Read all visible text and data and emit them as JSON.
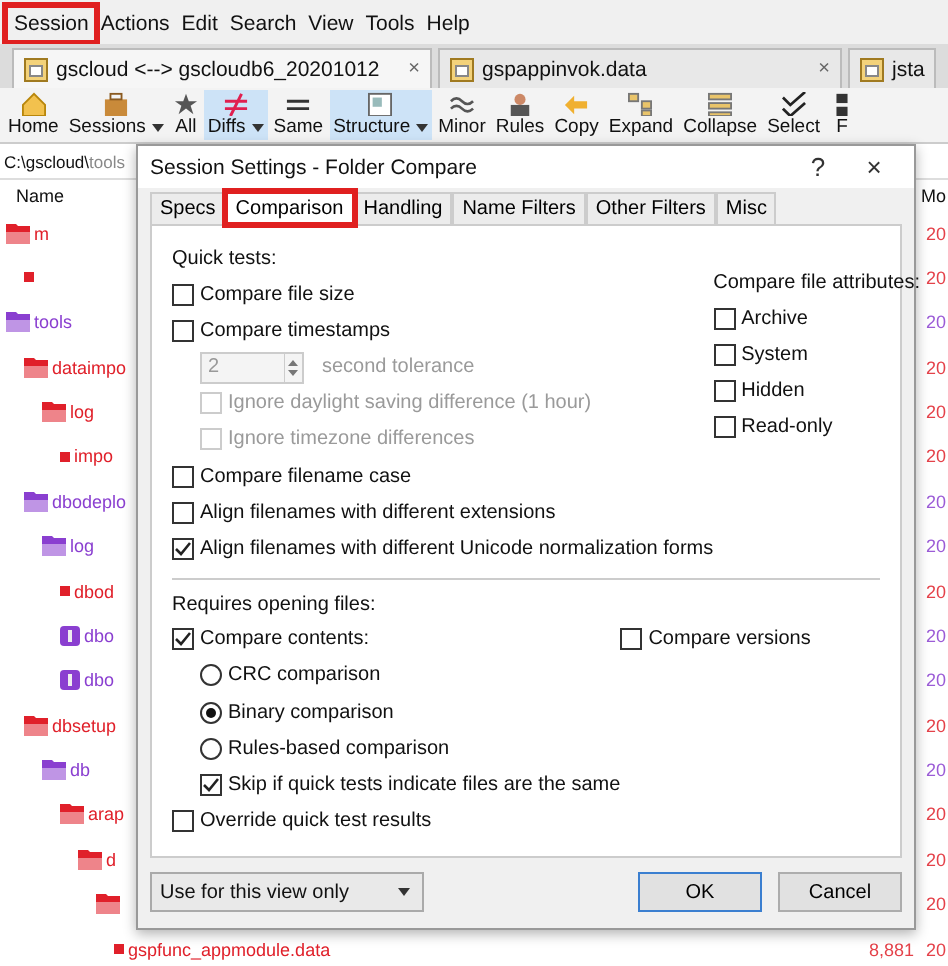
{
  "menu": [
    {
      "label": "Session",
      "highlighted": true
    },
    {
      "label": "Actions",
      "highlighted": false
    },
    {
      "label": "Edit",
      "highlighted": false
    },
    {
      "label": "Search",
      "highlighted": false
    },
    {
      "label": "View",
      "highlighted": false
    },
    {
      "label": "Tools",
      "highlighted": false
    },
    {
      "label": "Help",
      "highlighted": false
    }
  ],
  "doc_tabs": [
    {
      "label": "gscloud <--> gscloudb6_20201012",
      "selected": true,
      "close": "×"
    },
    {
      "label": "gspappinvok.data",
      "selected": false,
      "close": "×"
    },
    {
      "label": "jsta",
      "selected": false
    }
  ],
  "toolbar": [
    {
      "label": "Home",
      "selected": false,
      "dropdown": false
    },
    {
      "label": "Sessions",
      "selected": false,
      "dropdown": true
    },
    {
      "label": "All",
      "selected": false,
      "dropdown": false
    },
    {
      "label": "Diffs",
      "selected": true,
      "dropdown": true
    },
    {
      "label": "Same",
      "selected": false,
      "dropdown": false
    },
    {
      "label": "Structure",
      "selected": true,
      "dropdown": true
    },
    {
      "label": "Minor",
      "selected": false,
      "dropdown": false
    },
    {
      "label": "Rules",
      "selected": false,
      "dropdown": false
    },
    {
      "label": "Copy",
      "selected": false,
      "dropdown": false
    },
    {
      "label": "Expand",
      "selected": false,
      "dropdown": false
    },
    {
      "label": "Collapse",
      "selected": false,
      "dropdown": false
    },
    {
      "label": "Select",
      "selected": false,
      "dropdown": false
    },
    {
      "label": "F",
      "selected": false,
      "dropdown": false
    }
  ],
  "path": {
    "folder": "C:\\gscloud\\",
    "rest": "tools"
  },
  "tree": {
    "columns": [
      "Name",
      "Mo"
    ],
    "rows": [
      {
        "label": "m",
        "kind": "folder",
        "color": "#e0202a",
        "date": "20",
        "children": [
          {
            "kind": "file",
            "color": "#e0202a",
            "date": "20"
          }
        ]
      },
      {
        "label": "tools",
        "kind": "folder",
        "color": "#8a3fd0",
        "date": "20",
        "children": [
          {
            "label": "dataimpo",
            "kind": "folder",
            "color": "#e0202a",
            "date": "20",
            "children": [
              {
                "label": "log",
                "kind": "folder",
                "color": "#e0202a",
                "date": "20",
                "children": [
                  {
                    "label": "impo",
                    "kind": "file",
                    "color": "#e0202a",
                    "date": "20"
                  }
                ]
              }
            ]
          },
          {
            "label": "dbodeplo",
            "kind": "folder",
            "color": "#8a3fd0",
            "date": "20",
            "children": [
              {
                "label": "log",
                "kind": "folder",
                "color": "#8a3fd0",
                "date": "20",
                "children": [
                  {
                    "label": "dbod",
                    "kind": "file",
                    "color": "#e0202a",
                    "date": "20"
                  },
                  {
                    "label": "dbo",
                    "kind": "package",
                    "color": "#8a3fd0",
                    "date": "20"
                  },
                  {
                    "label": "dbo",
                    "kind": "package",
                    "color": "#8a3fd0",
                    "date": "20"
                  }
                ]
              }
            ]
          },
          {
            "label": "dbsetup",
            "kind": "folder",
            "color": "#e0202a",
            "date": "20",
            "children": [
              {
                "label": "db",
                "kind": "folder",
                "color": "#8a3fd0",
                "date": "20",
                "children": [
                  {
                    "label": "arap",
                    "kind": "folder",
                    "color": "#e0202a",
                    "date": "20",
                    "children": [
                      {
                        "label": "d",
                        "kind": "folder",
                        "color": "#e0202a",
                        "date": "20",
                        "children": [
                          {
                            "kind": "folder",
                            "color": "#e0202a",
                            "date": "20",
                            "children": [
                              {
                                "label": "gspfunc_appmodule.data",
                                "kind": "file",
                                "color": "#e0202a",
                                "size": "8,881",
                                "date": "20"
                              }
                            ]
                          }
                        ]
                      }
                    ]
                  }
                ]
              }
            ]
          }
        ]
      }
    ]
  },
  "dialog": {
    "title": "Session Settings - Folder Compare",
    "help": "?",
    "close": "×",
    "tabs": [
      {
        "label": "Specs",
        "selected": false,
        "highlighted": false
      },
      {
        "label": "Comparison",
        "selected": true,
        "highlighted": true
      },
      {
        "label": "Handling",
        "selected": false,
        "highlighted": false
      },
      {
        "label": "Name Filters",
        "selected": false,
        "highlighted": false
      },
      {
        "label": "Other Filters",
        "selected": false,
        "highlighted": false
      },
      {
        "label": "Misc",
        "selected": false,
        "highlighted": false
      }
    ],
    "quick_tests": {
      "heading": "Quick tests:",
      "items": [
        {
          "kind": "checkbox",
          "label": "Compare file size",
          "checked": false,
          "disabled": false,
          "indented": false
        },
        {
          "kind": "checkbox",
          "label": "Compare timestamps",
          "checked": false,
          "disabled": false,
          "indented": false,
          "tolerance": {
            "value": "2",
            "unit": "second tolerance",
            "disabled": true
          }
        },
        {
          "kind": "checkbox",
          "label": "Ignore daylight saving difference (1 hour)",
          "checked": false,
          "disabled": true,
          "indented": true
        },
        {
          "kind": "checkbox",
          "label": "Ignore timezone differences",
          "checked": false,
          "disabled": true,
          "indented": true
        },
        {
          "kind": "checkbox",
          "label": "Compare filename case",
          "checked": false,
          "disabled": false,
          "indented": false
        },
        {
          "kind": "checkbox",
          "label": "Align filenames with different extensions",
          "checked": false,
          "disabled": false,
          "indented": false
        },
        {
          "kind": "checkbox",
          "label": "Align filenames with different Unicode normalization forms",
          "checked": true,
          "disabled": false,
          "indented": false
        }
      ]
    },
    "attributes": {
      "heading": "Compare file attributes:",
      "items": [
        {
          "label": "Archive",
          "checked": false
        },
        {
          "label": "System",
          "checked": false
        },
        {
          "label": "Hidden",
          "checked": false
        },
        {
          "label": "Read-only",
          "checked": false
        }
      ]
    },
    "opening": {
      "heading": "Requires opening files:",
      "items": [
        {
          "kind": "checkbox",
          "label": "Compare contents:",
          "checked": true,
          "indented": false
        },
        {
          "kind": "radio",
          "label": "CRC comparison",
          "selected": false
        },
        {
          "kind": "radio",
          "label": "Binary comparison",
          "selected": true
        },
        {
          "kind": "radio",
          "label": "Rules-based comparison",
          "selected": false
        },
        {
          "kind": "checkbox",
          "label": "Skip if quick tests indicate files are the same",
          "checked": true,
          "indented": true
        },
        {
          "kind": "checkbox",
          "label": "Override quick test results",
          "checked": false,
          "indented": false
        }
      ],
      "versions": {
        "label": "Compare versions",
        "checked": false
      }
    },
    "scope": "Use for this view only",
    "buttons": [
      {
        "label": "OK",
        "default": true
      },
      {
        "label": "Cancel",
        "default": false
      }
    ]
  }
}
